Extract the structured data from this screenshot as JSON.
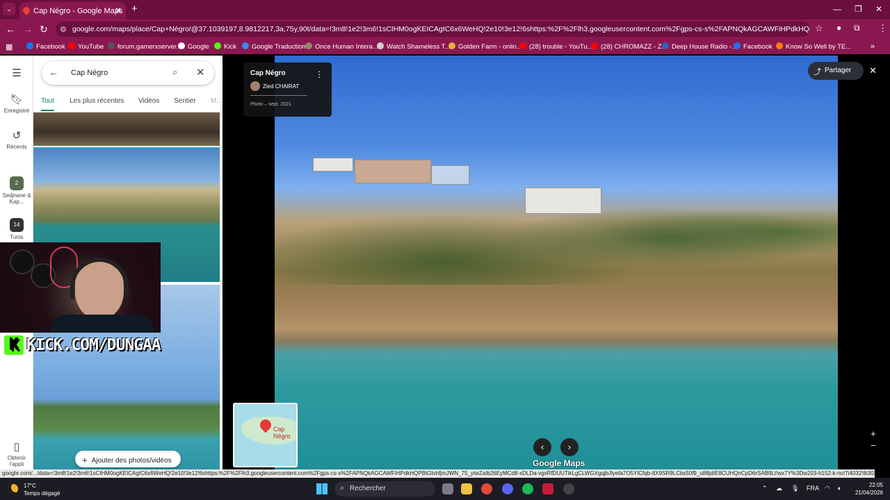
{
  "browser": {
    "tab_title": "Cap Négro - Google Maps",
    "new_tab": "+",
    "tab_menu": "⌄",
    "window": {
      "minimize": "—",
      "restore": "❐",
      "close": "✕"
    },
    "url": "google.com/maps/place/Cap+Négro/@37.1039197,8.9812217,3a,75y,90t/data=!3m8!1e2!3m6!1sCIHM0ogKEICAgIC6x6WeHQ!2e10!3e12!6shttps:%2F%2Flh3.googleusercontent.com%2Fgps-cs-s%2FAPNQkAGCAWFiHPdkHQPBtGtvhfjmJWN_75_...",
    "nav": {
      "back": "←",
      "forward": "→",
      "reload": "↻",
      "tune": "⚙"
    },
    "bookmarks": [
      {
        "label": "Facebook",
        "color": "#1877f2"
      },
      {
        "label": "YouTube",
        "color": "#ff0000"
      },
      {
        "label": "forum.gamerxserver...",
        "color": "#555555"
      },
      {
        "label": "Google",
        "color": "#ffffff"
      },
      {
        "label": "Kick",
        "color": "#53fc18"
      },
      {
        "label": "Google Traduction",
        "color": "#4285f4"
      },
      {
        "label": "Once Human Intera...",
        "color": "#8a8a6a"
      },
      {
        "label": "Watch Shameless T...",
        "color": "#d0d0d0"
      },
      {
        "label": "Golden Farm - onlin...",
        "color": "#e8b030"
      },
      {
        "label": "(28) trouble - YouTu...",
        "color": "#ff0000"
      },
      {
        "label": "(28) CHROMAZZ - Z...",
        "color": "#ff0000"
      },
      {
        "label": "Deep House Radio -...",
        "color": "#3060c0"
      },
      {
        "label": "Facebook",
        "color": "#1877f2"
      },
      {
        "label": "Know So Well by TE...",
        "color": "#ff7a00"
      }
    ]
  },
  "maps": {
    "rail": {
      "menu": "☰",
      "saved": "Enregistré",
      "recents": "Récents",
      "place1": "Sedjnane & Kap...",
      "place1_count": "2",
      "place2": "Tunis",
      "place2_count": "14",
      "app": "Obtenir l'appli"
    },
    "search": {
      "query": "Cap Négro",
      "back": "←",
      "search_icon": "⌕",
      "clear": "✕"
    },
    "filters": [
      "Tout",
      "Les plus récentes",
      "Vidéos",
      "Sentier",
      "M..."
    ],
    "add_button": "Ajouter des photos/vidéos",
    "add_plus": "+",
    "collapse": "◀",
    "photo_card": {
      "title": "Cap Négro",
      "author": "Zied CHAIRAT",
      "date": "Photo – sept. 2021",
      "menu": "⋮"
    },
    "share": "Partager",
    "share_icon": "⤴",
    "close": "✕",
    "minimap_label": "Cap Négro",
    "prev": "‹",
    "next": "›",
    "logo": "Google Maps",
    "zoom_in": "+",
    "zoom_out": "−"
  },
  "overlay": {
    "kick_text": "KICK.COM/DUNGAA",
    "kick_letter": "K"
  },
  "status_url": "google.com/.../data=!3m8!1e2!3m6!1sCIHM0ogKEICAgIC6x6WeHQ!2e10!3e12!6shttps:%2F%2Flh3.googleusercontent.com%2Fgps-cs-s%2FAPNQkAGCAWFiHPdkHQPBtGtvhfjmJWN_75_ytwZaIb26EyMCd8-xDLDa-vgxRfDUUTikLgCLWGXgqjbJlyefa7O5YlCfqb-8X9SR9LCbs50f9_u88jdIE8CUHQnCpD6rSAB9Lt!wx7Y%3Dw203-h152-k-no!7i4032!8i3024!4m7!3...",
  "taskbar": {
    "temp": "17°C",
    "weather": "Temps dégagé",
    "search": "Rechercher",
    "search_icon": "⌕",
    "lang": "FRA",
    "time": "22:05",
    "date": "21/04/2026",
    "tray_up": "⌃"
  }
}
